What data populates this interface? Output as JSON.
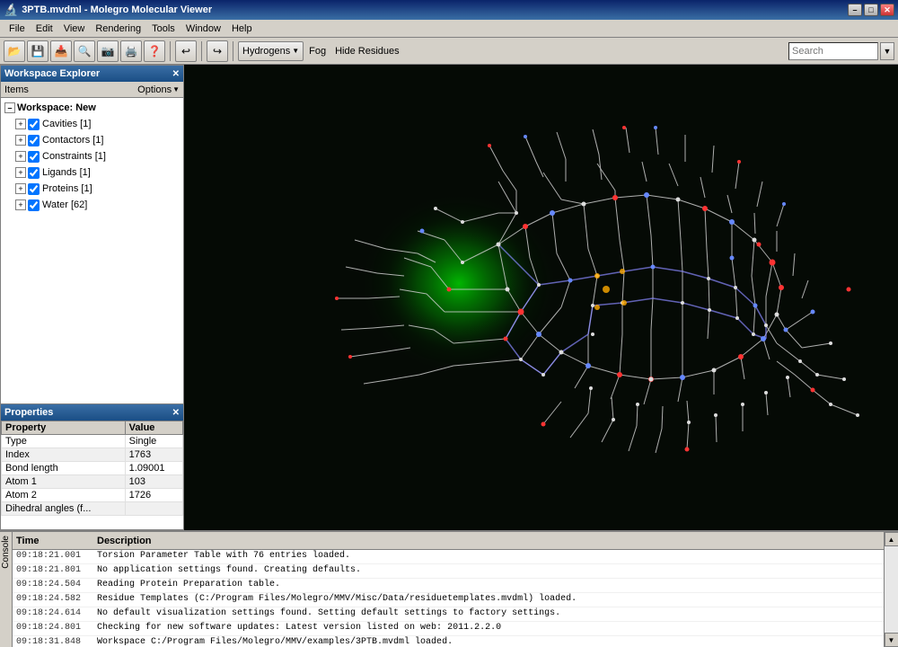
{
  "titlebar": {
    "title": "3PTB.mvdml - Molegro Molecular Viewer",
    "icon": "🔬",
    "minimize": "–",
    "maximize": "□",
    "close": "✕"
  },
  "menubar": {
    "items": [
      "File",
      "Edit",
      "View",
      "Rendering",
      "Tools",
      "Window",
      "Help"
    ]
  },
  "toolbar": {
    "search_placeholder": "Search",
    "hydrogens_label": "Hydrogens",
    "fog_label": "Fog",
    "hide_residues_label": "Hide Residues",
    "dropdown_arrow": "▼"
  },
  "workspace": {
    "title": "Workspace Explorer",
    "items_label": "Items",
    "options_label": "Options",
    "workspace_name": "Workspace: New",
    "tree_items": [
      {
        "label": "Cavities [1]",
        "checked": true,
        "id": "cavities"
      },
      {
        "label": "Contactors [1]",
        "checked": true,
        "id": "contactors"
      },
      {
        "label": "Constraints [1]",
        "checked": true,
        "id": "constraints"
      },
      {
        "label": "Ligands [1]",
        "checked": true,
        "id": "ligands"
      },
      {
        "label": "Proteins [1]",
        "checked": true,
        "id": "proteins"
      },
      {
        "label": "Water [62]",
        "checked": true,
        "id": "water"
      }
    ]
  },
  "properties": {
    "title": "Properties",
    "columns": [
      "Property",
      "Value"
    ],
    "rows": [
      {
        "property": "Type",
        "value": "Single"
      },
      {
        "property": "Index",
        "value": "1763"
      },
      {
        "property": "Bond length",
        "value": "1.09001"
      },
      {
        "property": "Atom 1",
        "value": "103"
      },
      {
        "property": "Atom 2",
        "value": "1726"
      },
      {
        "property": "Dihedral angles (f...",
        "value": ""
      }
    ]
  },
  "log": {
    "time_header": "Time",
    "desc_header": "Description",
    "console_label": "Console",
    "entries": [
      {
        "time": "09:18:21.001",
        "desc": "Torsion Parameter Table with 76 entries loaded."
      },
      {
        "time": "09:18:21.801",
        "desc": "No application settings found. Creating defaults."
      },
      {
        "time": "09:18:24.504",
        "desc": "Reading Protein Preparation table."
      },
      {
        "time": "09:18:24.582",
        "desc": "Residue Templates (C:/Program Files/Molegro/MMV/Misc/Data/residuetemplates.mvdml) loaded."
      },
      {
        "time": "09:18:24.614",
        "desc": "No default visualization settings found. Setting default settings to factory settings."
      },
      {
        "time": "09:18:24.801",
        "desc": "Checking for new software updates: Latest version listed on web: 2011.2.2.0"
      },
      {
        "time": "09:18:31.848",
        "desc": "Workspace C:/Program Files/Molegro/MMV/examples/3PTB.mvdml loaded."
      }
    ]
  }
}
